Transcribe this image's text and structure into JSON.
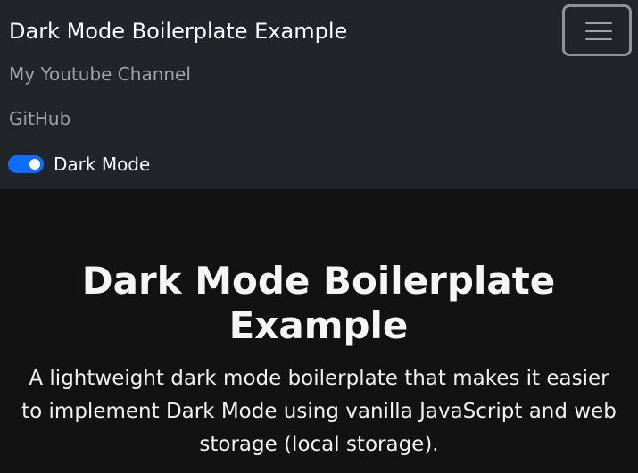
{
  "navbar": {
    "brand": "Dark Mode Boilerplate Example",
    "toggler_icon": "hamburger-menu-icon",
    "links": [
      {
        "label": "My Youtube Channel"
      },
      {
        "label": "GitHub"
      }
    ],
    "dark_mode_switch": {
      "label": "Dark Mode",
      "checked": true,
      "accent_color": "#0d6efd"
    }
  },
  "hero": {
    "title": "Dark Mode Boilerplate Example",
    "description": "A lightweight dark mode boilerplate that makes it easier to implement Dark Mode using vanilla JavaScript and web storage (local storage)."
  },
  "colors": {
    "navbar_background": "#212529",
    "page_background": "#121212",
    "text_primary": "#ffffff",
    "text_muted": "#a0a4a9"
  }
}
